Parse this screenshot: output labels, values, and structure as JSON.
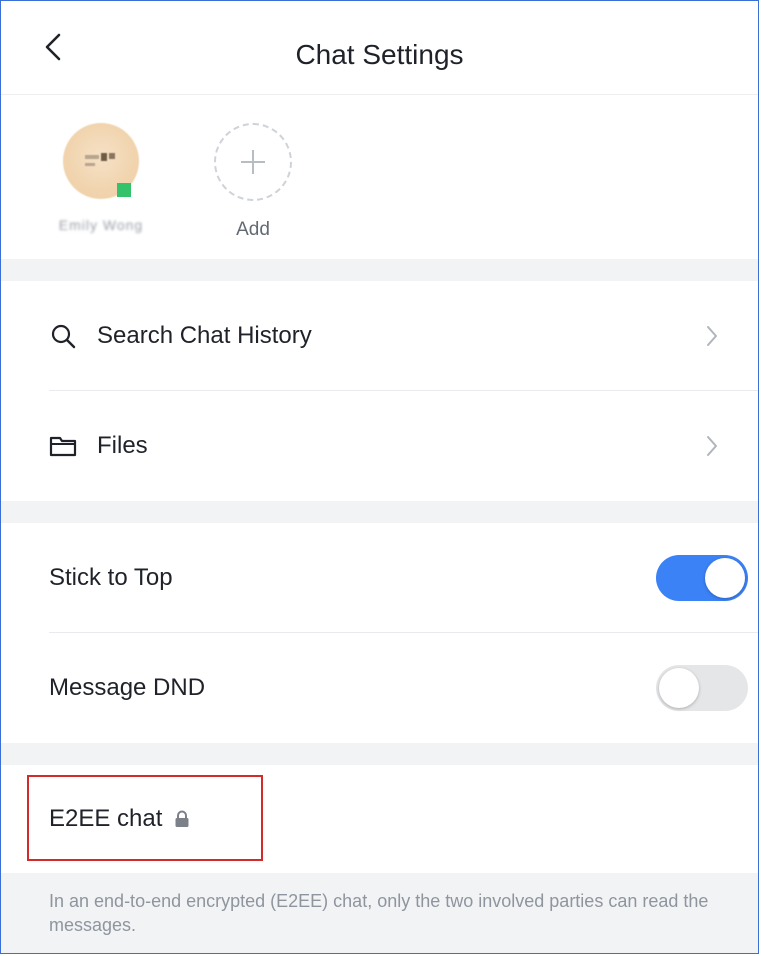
{
  "header": {
    "title": "Chat Settings"
  },
  "members": {
    "member_name": "Emily Wong",
    "add_label": "Add"
  },
  "menu": {
    "search_label": "Search Chat History",
    "files_label": "Files"
  },
  "toggles": {
    "stick_to_top_label": "Stick to Top",
    "stick_to_top_on": true,
    "message_dnd_label": "Message DND",
    "message_dnd_on": false
  },
  "e2ee": {
    "label": "E2EE chat",
    "description": "In an end-to-end encrypted (E2EE) chat, only the two involved parties can read the messages."
  },
  "colors": {
    "accent": "#3b82f6",
    "toggle_off": "#e5e6e8",
    "highlight_border": "#d42a2a",
    "presence_online": "#34c36a"
  }
}
